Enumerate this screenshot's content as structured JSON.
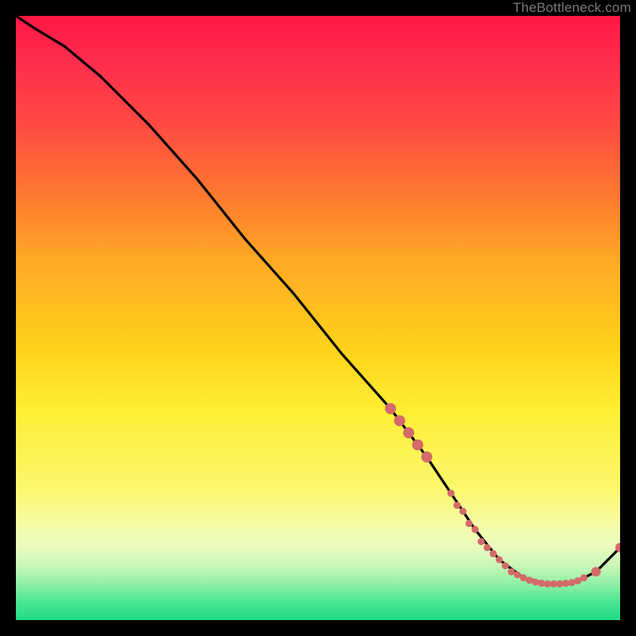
{
  "watermark": "TheBottleneck.com",
  "chart_data": {
    "type": "line",
    "title": "",
    "xlabel": "",
    "ylabel": "",
    "xlim": [
      0,
      100
    ],
    "ylim": [
      0,
      100
    ],
    "grid": false,
    "series": [
      {
        "name": "curve",
        "color": "#000000",
        "x": [
          0,
          3,
          8,
          14,
          22,
          30,
          38,
          46,
          54,
          62,
          68,
          72,
          76,
          80,
          84,
          88,
          92,
          96,
          100
        ],
        "values": [
          100,
          98,
          95,
          90,
          82,
          73,
          63,
          54,
          44,
          35,
          27,
          21,
          15,
          10,
          7,
          6,
          6,
          8,
          12
        ]
      },
      {
        "name": "markers",
        "color": "#d46a6a",
        "x": [
          62,
          63.5,
          65,
          66.5,
          68,
          72,
          73,
          74,
          75,
          76,
          77,
          78,
          79,
          80,
          81,
          82,
          83,
          84,
          85,
          86,
          87,
          88,
          89,
          90,
          91,
          92,
          93,
          94,
          96,
          100
        ],
        "values": [
          35,
          33,
          31,
          29,
          27,
          21,
          19,
          18,
          16,
          15,
          13,
          12,
          11,
          10,
          9,
          8,
          7.5,
          7,
          6.6,
          6.3,
          6.1,
          6,
          6,
          6,
          6.1,
          6.2,
          6.5,
          7,
          8,
          12
        ]
      }
    ]
  },
  "colors": {
    "marker": "#d46a6a",
    "curve": "#000000"
  }
}
